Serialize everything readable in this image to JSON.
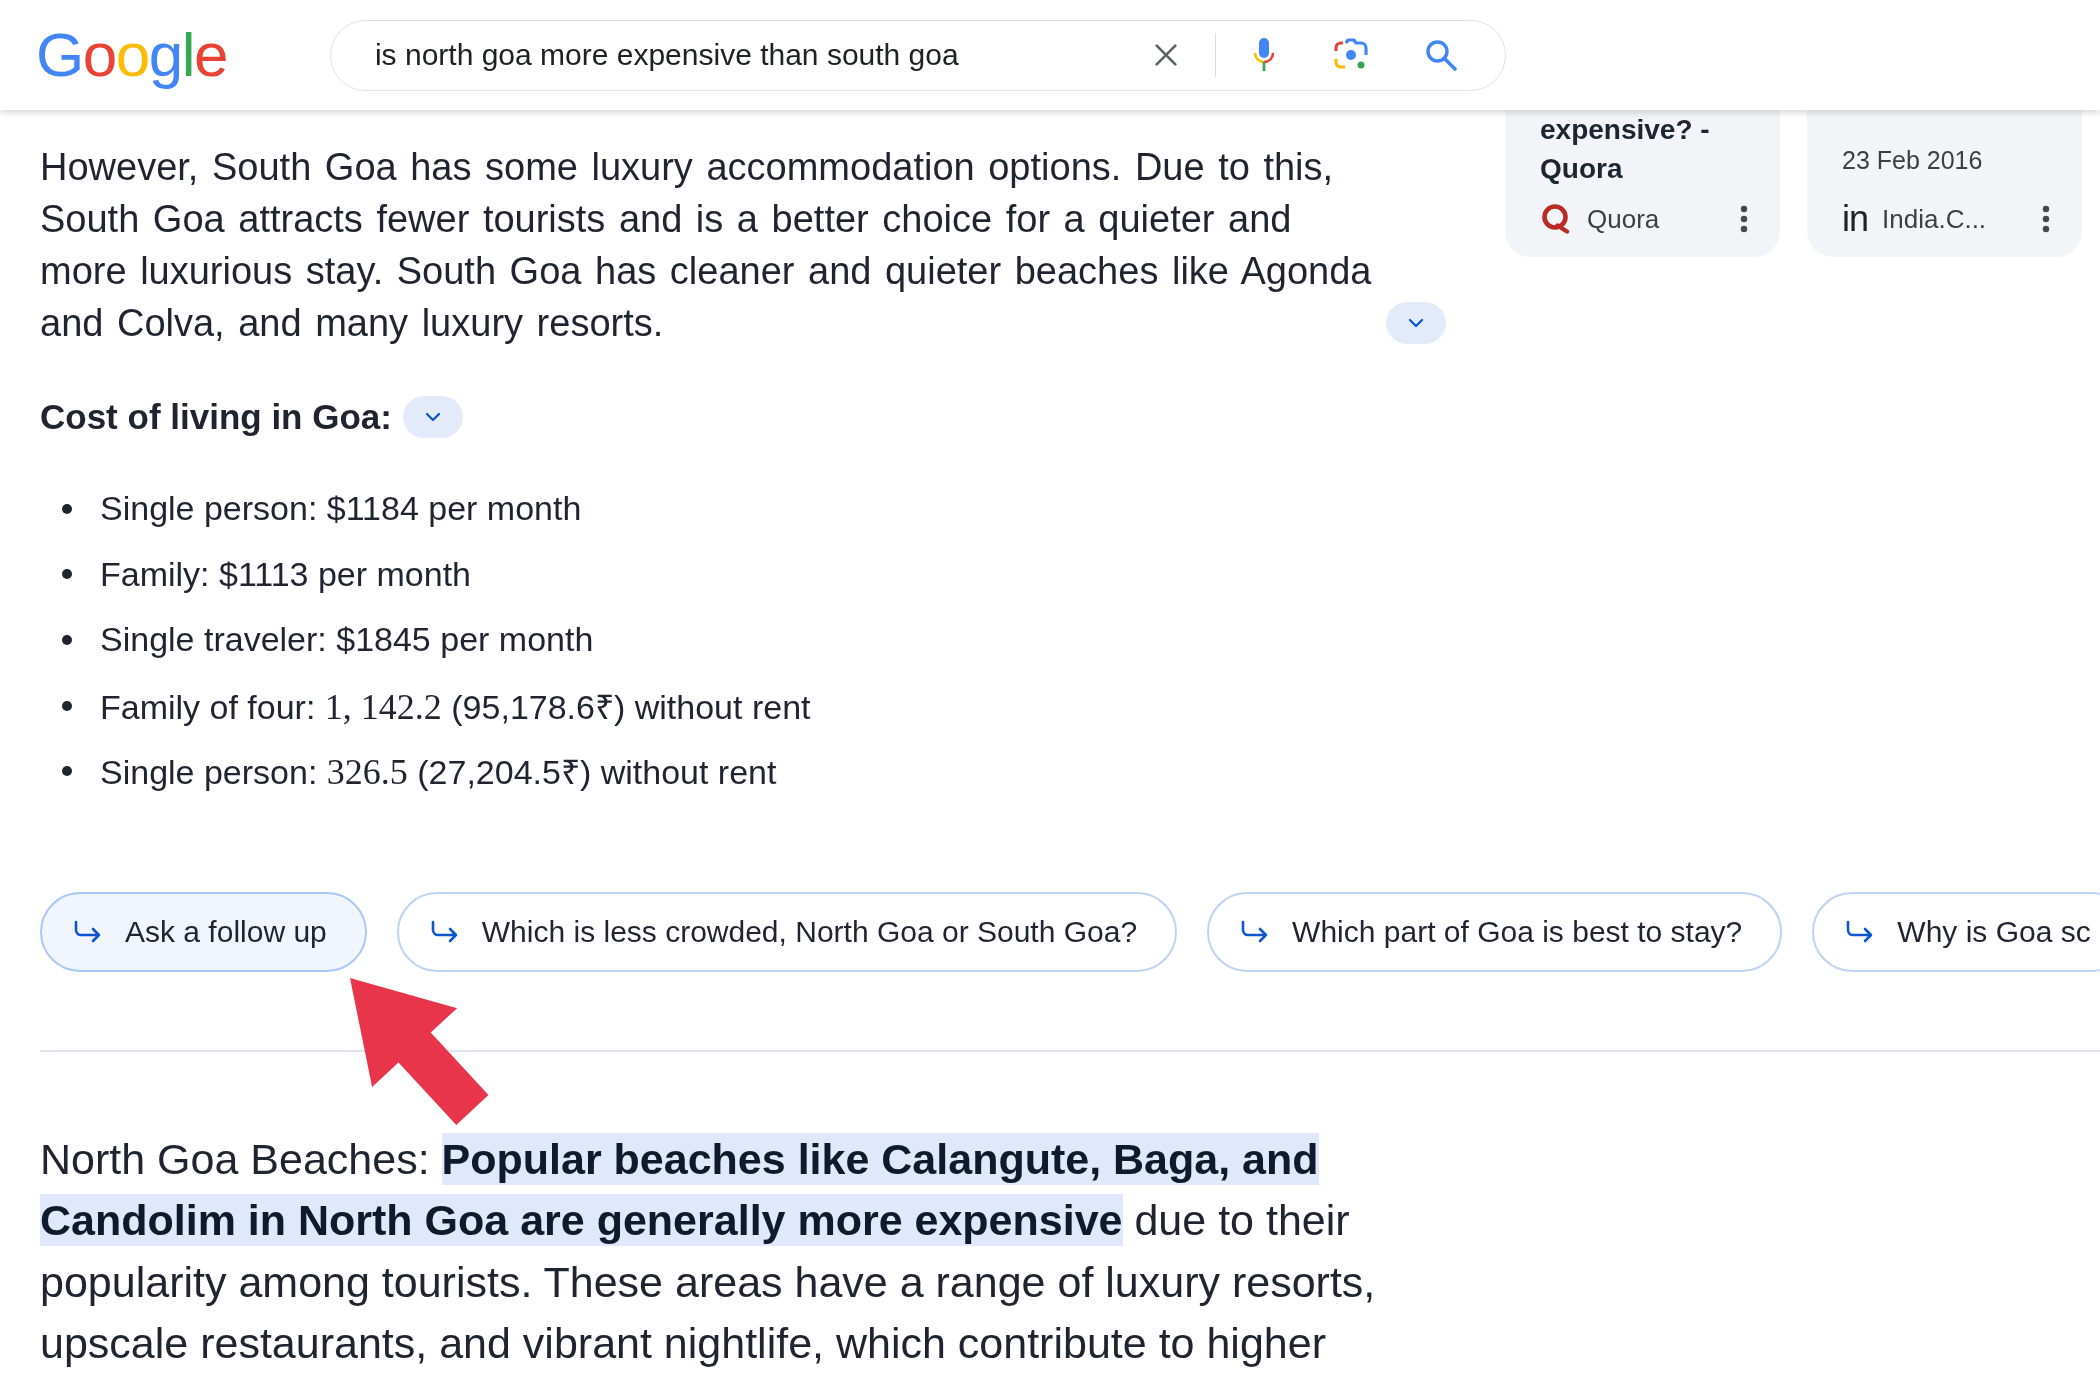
{
  "header": {
    "logo": "Google",
    "search": {
      "value": "is north goa more expensive than south goa"
    }
  },
  "source_cards": [
    {
      "title": "expensive? - Quora",
      "source": "Quora",
      "logo": {
        "kind": "ring"
      }
    },
    {
      "date": "23 Feb 2016",
      "source": "India.C...",
      "logo": {
        "kind": "text",
        "text": "in"
      }
    }
  ],
  "overview": {
    "text": "However, South Goa has some luxury accommodation options. Due to this, South Goa attracts fewer tourists and is a better choice for a quieter and more luxurious stay. South Goa has cleaner and quieter beaches like Agonda and Colva, and many luxury resorts.",
    "expanded": false
  },
  "cost_heading": {
    "text": "Cost of living in Goa:",
    "expanded": false
  },
  "cost_list": [
    {
      "segments": [
        {
          "kind": "text",
          "text": "Single person: $1184 per month"
        }
      ]
    },
    {
      "segments": [
        {
          "kind": "text",
          "text": "Family: $1113 per month"
        }
      ]
    },
    {
      "segments": [
        {
          "kind": "text",
          "text": "Single traveler: $1845 per month"
        }
      ]
    },
    {
      "segments": [
        {
          "kind": "text",
          "text": "Family of four: "
        },
        {
          "kind": "math",
          "text": "1, 142.2"
        },
        {
          "kind": "text",
          "text": " (95,178.6₹) without rent"
        }
      ]
    },
    {
      "segments": [
        {
          "kind": "text",
          "text": "Single person: "
        },
        {
          "kind": "math",
          "text": "326.5"
        },
        {
          "kind": "text",
          "text": " (27,204.5₹) without rent"
        }
      ]
    }
  ],
  "follow_ups": [
    {
      "kind": "ask",
      "label": "Ask a follow up"
    },
    {
      "kind": "suggestion",
      "label": "Which is less crowded, North Goa or South Goa?"
    },
    {
      "kind": "suggestion",
      "label": "Which part of Goa is best to stay?"
    },
    {
      "kind": "suggestion",
      "label": "Why is Goa sc"
    }
  ],
  "answer": {
    "text": "North Goa Beaches: **Popular beaches like Calangute, Baga, and Candolim in North Goa are generally more expensive** due to their popularity among tourists. These areas have a range of luxury resorts, upscale restaurants, and vibrant nightlife, which contribute to higher"
  },
  "annotation": {
    "kind": "arrow"
  }
}
